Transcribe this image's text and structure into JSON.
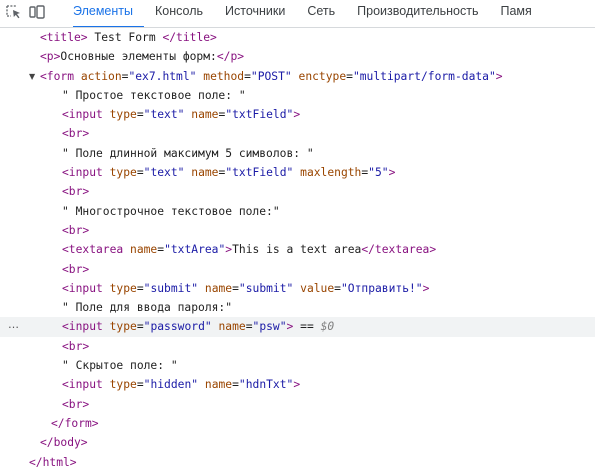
{
  "tabbar": {
    "icons": [
      "inspect-element-icon",
      "device-toolbar-icon"
    ],
    "tabs": [
      {
        "label": "Элементы",
        "active": true
      },
      {
        "label": "Консоль",
        "active": false
      },
      {
        "label": "Источники",
        "active": false
      },
      {
        "label": "Сеть",
        "active": false
      },
      {
        "label": "Производительность",
        "active": false
      },
      {
        "label": "Памя",
        "active": false
      }
    ]
  },
  "colors": {
    "tag": "#881280",
    "attr_name": "#994500",
    "attr_value": "#1a1aa6",
    "active_tab": "#1a73e8"
  },
  "dom": {
    "title_open": "<title>",
    "title_text": " Test Form ",
    "title_close": "</title>",
    "p_open": "<p>",
    "p_text": "Основные элементы форм:",
    "p_close": "</p>",
    "form_tag": "<form",
    "form_action_name": "action",
    "form_action_val": "\"ex7.html\"",
    "form_method_name": "method",
    "form_method_val": "\"POST\"",
    "form_enctype_name": "enctype",
    "form_enctype_val": "\"multipart/form-data\"",
    "form_gt": ">",
    "text1": "\" Простое текстовое поле: \"",
    "input_tag": "<input",
    "type_name": "type",
    "name_name": "name",
    "maxlength_name": "maxlength",
    "value_name": "value",
    "gt": ">",
    "text_val": "\"text\"",
    "txtField_val": "\"txtField\"",
    "br": "<br>",
    "text2": "\" Поле длинной максимум 5 символов: \"",
    "maxlength_val": "\"5\"",
    "text3": "\" Многострочное текстовое поле:\"",
    "textarea_open": "<textarea",
    "txtArea_val": "\"txtArea\"",
    "textarea_content": "This is a text area",
    "textarea_close": "</textarea>",
    "submit_val": "\"submit\"",
    "submit_value_val": "\"Отправить!\"",
    "text4": "\" Поле для ввода пароля:\"",
    "password_val": "\"password\"",
    "psw_val": "\"psw\"",
    "selected_marker_eq": " == ",
    "selected_marker_var": "$0",
    "text5": "\" Скрытое поле: \"",
    "hidden_val": "\"hidden\"",
    "hdnTxt_val": "\"hdnTxt\"",
    "form_close": "</form>",
    "body_close": "</body>",
    "html_close": "</html>",
    "ellipsis": "…"
  }
}
